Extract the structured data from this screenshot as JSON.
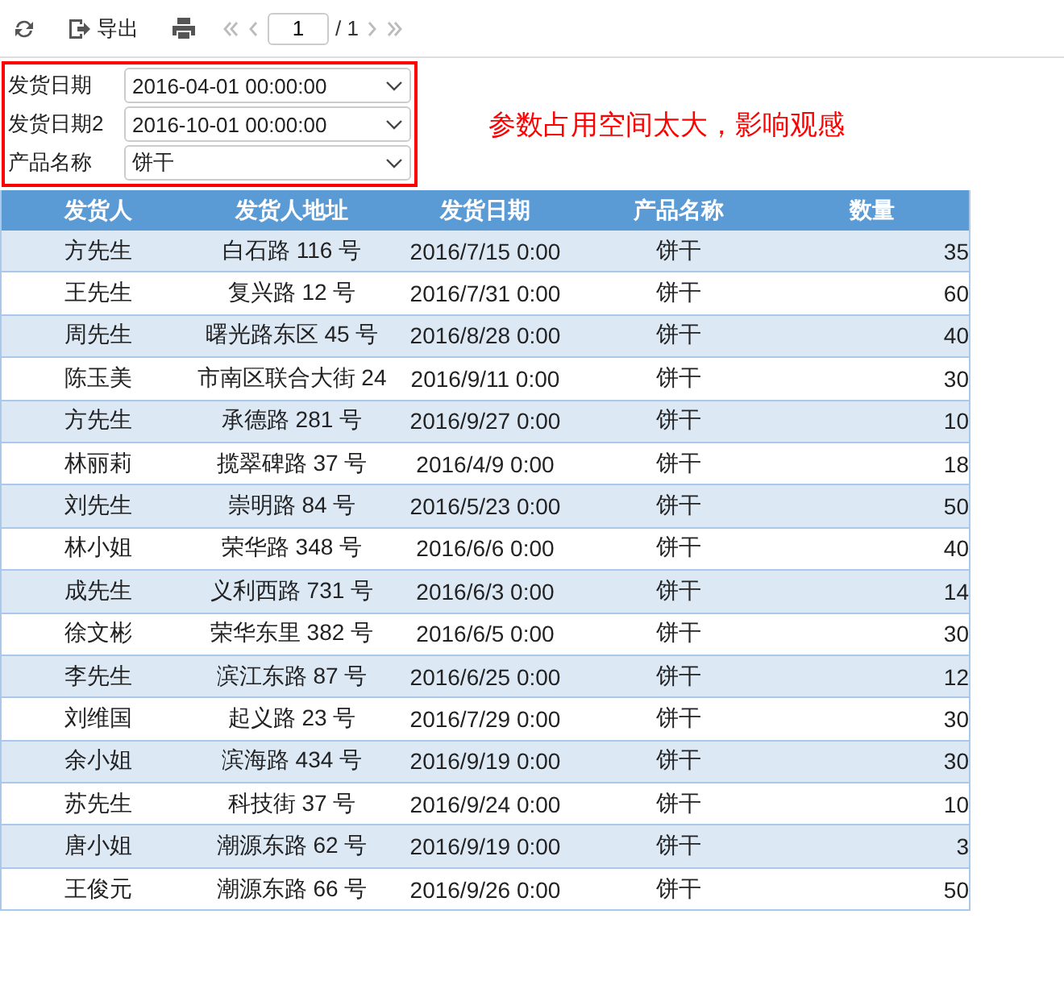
{
  "toolbar": {
    "export_label": "导出",
    "page_input": "1",
    "page_total": "/ 1"
  },
  "parameters": [
    {
      "label": "发货日期",
      "value": "2016-04-01 00:00:00"
    },
    {
      "label": "发货日期2",
      "value": "2016-10-01 00:00:00"
    },
    {
      "label": "产品名称",
      "value": "饼干"
    }
  ],
  "note": "参数占用空间太大，影响观感",
  "table": {
    "columns": [
      "发货人",
      "发货人地址",
      "发货日期",
      "产品名称",
      "数量"
    ],
    "rows": [
      [
        "方先生",
        "白石路 116 号",
        "2016/7/15 0:00",
        "饼干",
        "35"
      ],
      [
        "王先生",
        "复兴路 12 号",
        "2016/7/31 0:00",
        "饼干",
        "60"
      ],
      [
        "周先生",
        "曙光路东区 45 号",
        "2016/8/28 0:00",
        "饼干",
        "40"
      ],
      [
        "陈玉美",
        "市南区联合大街 24",
        "2016/9/11 0:00",
        "饼干",
        "30"
      ],
      [
        "方先生",
        "承德路 281 号",
        "2016/9/27 0:00",
        "饼干",
        "10"
      ],
      [
        "林丽莉",
        "揽翠碑路 37 号",
        "2016/4/9 0:00",
        "饼干",
        "18"
      ],
      [
        "刘先生",
        "崇明路 84 号",
        "2016/5/23 0:00",
        "饼干",
        "50"
      ],
      [
        "林小姐",
        "荣华路 348 号",
        "2016/6/6 0:00",
        "饼干",
        "40"
      ],
      [
        "成先生",
        "义利西路 731 号",
        "2016/6/3 0:00",
        "饼干",
        "14"
      ],
      [
        "徐文彬",
        "荣华东里 382 号",
        "2016/6/5 0:00",
        "饼干",
        "30"
      ],
      [
        "李先生",
        "滨江东路 87 号",
        "2016/6/25 0:00",
        "饼干",
        "12"
      ],
      [
        "刘维国",
        "起义路 23 号",
        "2016/7/29 0:00",
        "饼干",
        "30"
      ],
      [
        "余小姐",
        "滨海路 434 号",
        "2016/9/19 0:00",
        "饼干",
        "30"
      ],
      [
        "苏先生",
        "科技街 37 号",
        "2016/9/24 0:00",
        "饼干",
        "10"
      ],
      [
        "唐小姐",
        "潮源东路 62 号",
        "2016/9/19 0:00",
        "饼干",
        "3"
      ],
      [
        "王俊元",
        "潮源东路 66 号",
        "2016/9/26 0:00",
        "饼干",
        "50"
      ]
    ]
  }
}
